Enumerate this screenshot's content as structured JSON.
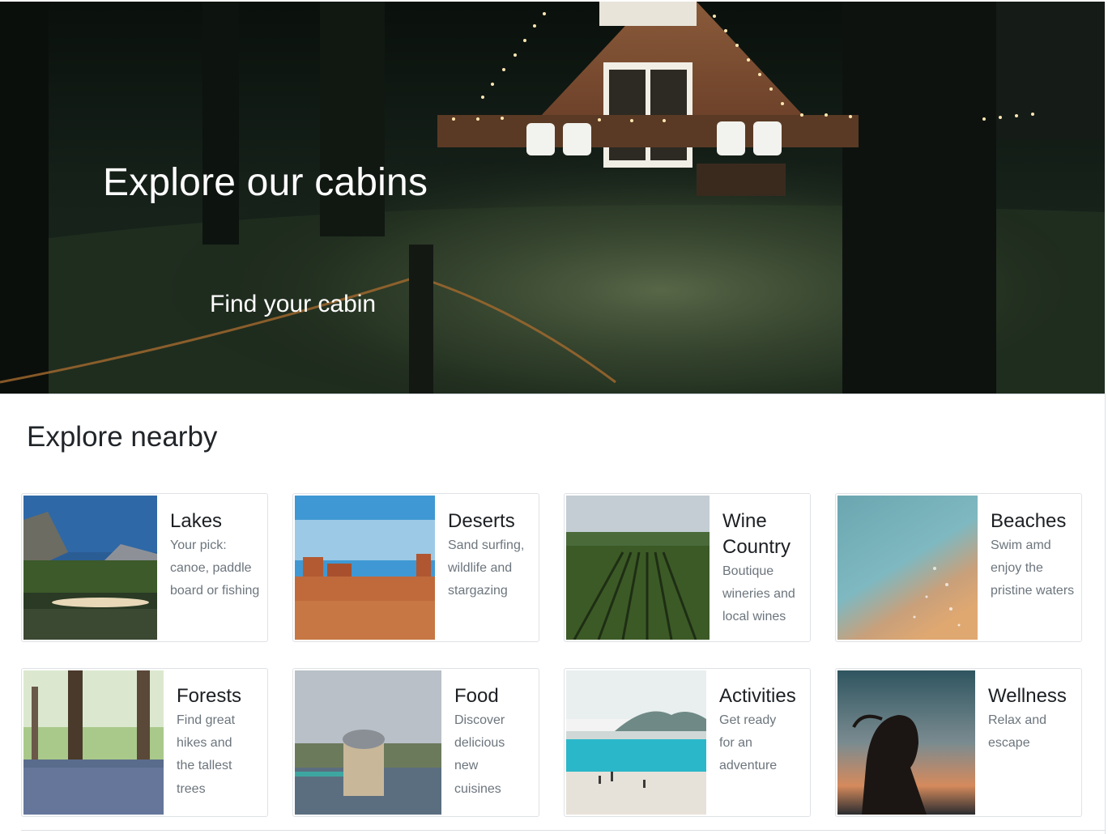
{
  "hero": {
    "title": "Explore our cabins",
    "cta": "Find your cabin"
  },
  "explore": {
    "heading": "Explore nearby",
    "cards": [
      {
        "title": "Lakes",
        "text": "Your pick: canoe, paddle board or fishing"
      },
      {
        "title": "Deserts",
        "text": "Sand surfing, wildlife and stargazing"
      },
      {
        "title": "Wine Country",
        "text": "Boutique wineries and local wines"
      },
      {
        "title": "Beaches",
        "text": "Swim amd enjoy the pristine waters"
      },
      {
        "title": "Forests",
        "text": "Find great hikes and the tallest trees"
      },
      {
        "title": "Food",
        "text": "Discover delicious new cuisines"
      },
      {
        "title": "Activities",
        "text": "Get ready for an adventure"
      },
      {
        "title": "Wellness",
        "text": "Relax and escape"
      }
    ]
  }
}
